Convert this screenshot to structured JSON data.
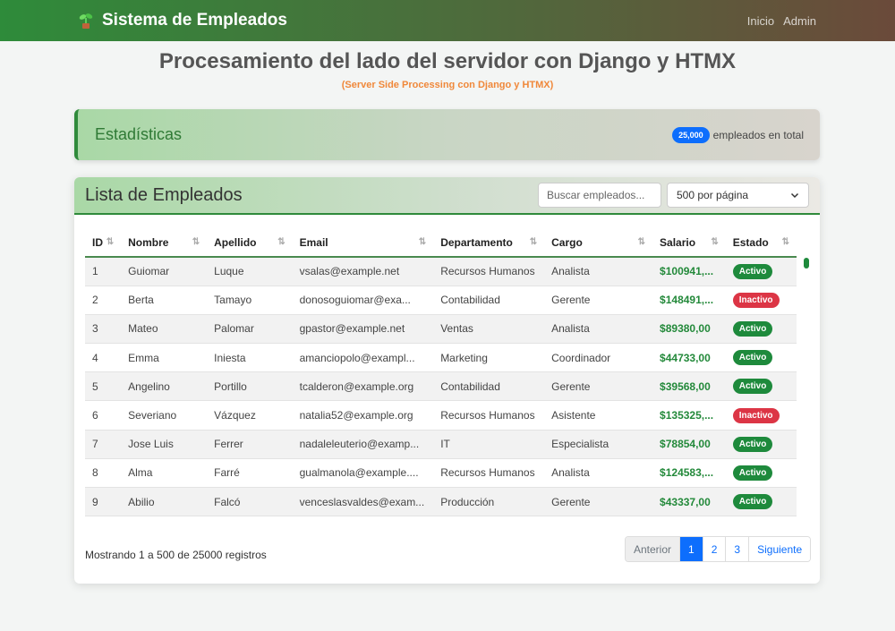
{
  "navbar": {
    "brand": "Sistema de Empleados",
    "links": [
      "Inicio",
      "Admin"
    ]
  },
  "header": {
    "title": "Procesamiento del lado del servidor con Django y HTMX",
    "subtitle": "(Server Side Processing con Django y HTMX)"
  },
  "stats": {
    "title": "Estadísticas",
    "count": "25,000",
    "count_text": "empleados en total"
  },
  "list": {
    "title": "Lista de Empleados",
    "search_placeholder": "Buscar empleados...",
    "per_page": "500 por página"
  },
  "table": {
    "columns": [
      "ID",
      "Nombre",
      "Apellido",
      "Email",
      "Departamento",
      "Cargo",
      "Salario",
      "Estado"
    ],
    "rows": [
      [
        "1",
        "Guiomar",
        "Luque",
        "vsalas@example.net",
        "Recursos Humanos",
        "Analista",
        "$100941,...",
        "Activo"
      ],
      [
        "2",
        "Berta",
        "Tamayo",
        "donosoguiomar@exa...",
        "Contabilidad",
        "Gerente",
        "$148491,...",
        "Inactivo"
      ],
      [
        "3",
        "Mateo",
        "Palomar",
        "gpastor@example.net",
        "Ventas",
        "Analista",
        "$89380,00",
        "Activo"
      ],
      [
        "4",
        "Emma",
        "Iniesta",
        "amanciopolo@exampl...",
        "Marketing",
        "Coordinador",
        "$44733,00",
        "Activo"
      ],
      [
        "5",
        "Angelino",
        "Portillo",
        "tcalderon@example.org",
        "Contabilidad",
        "Gerente",
        "$39568,00",
        "Activo"
      ],
      [
        "6",
        "Severiano",
        "Vázquez",
        "natalia52@example.org",
        "Recursos Humanos",
        "Asistente",
        "$135325,...",
        "Inactivo"
      ],
      [
        "7",
        "Jose Luis",
        "Ferrer",
        "nadaleleuterio@examp...",
        "IT",
        "Especialista",
        "$78854,00",
        "Activo"
      ],
      [
        "8",
        "Alma",
        "Farré",
        "gualmanola@example....",
        "Recursos Humanos",
        "Analista",
        "$124583,...",
        "Activo"
      ],
      [
        "9",
        "Abilio",
        "Falcó",
        "venceslasvaldes@exam...",
        "Producción",
        "Gerente",
        "$43337,00",
        "Activo"
      ]
    ]
  },
  "footer": {
    "info": "Mostrando 1 a 500 de 25000 registros"
  },
  "pagination": {
    "prev": "Anterior",
    "pages": [
      "1",
      "2",
      "3"
    ],
    "next": "Siguiente"
  }
}
